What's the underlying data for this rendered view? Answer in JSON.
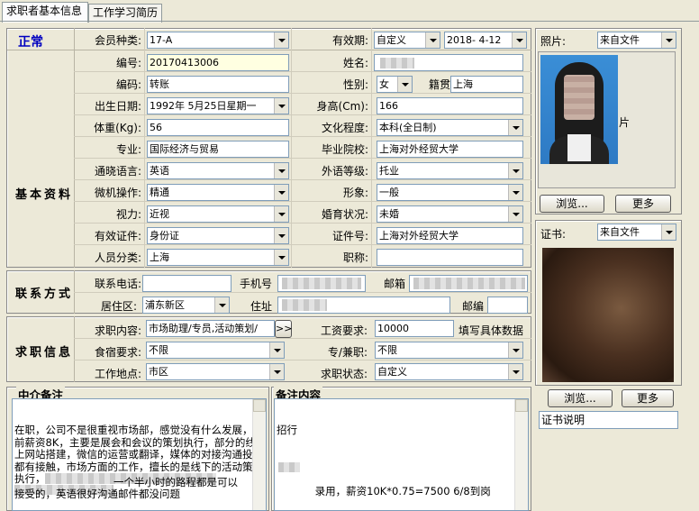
{
  "tabs": [
    {
      "label": "求职者基本信息"
    },
    {
      "label": "工作学习简历"
    }
  ],
  "status": "正常",
  "member_type": {
    "label": "会员种类:",
    "value": "17-A"
  },
  "validity": {
    "label": "有效期:",
    "mode": "自定义",
    "date": "2018- 4-12"
  },
  "photo": {
    "label": "照片:",
    "source": "来自文件",
    "placeholder_text": "片",
    "browse": "浏览...",
    "more": "更多"
  },
  "basic": {
    "section": "基本资料",
    "id": {
      "label": "编号:",
      "value": "20170413006"
    },
    "name": {
      "label": "姓名:"
    },
    "code": {
      "label": "编码:",
      "value": "转账"
    },
    "gender": {
      "label": "性别:",
      "value": "女"
    },
    "native": {
      "label": "籍贯",
      "value": "上海"
    },
    "birth": {
      "label": "出生日期:",
      "value": "1992年 5月25日星期一"
    },
    "height": {
      "label": "身高(Cm):",
      "value": "166"
    },
    "weight": {
      "label": "体重(Kg):",
      "value": "56"
    },
    "education": {
      "label": "文化程度:",
      "value": "本科(全日制)"
    },
    "major": {
      "label": "专业:",
      "value": "国际经济与贸易"
    },
    "school": {
      "label": "毕业院校:",
      "value": "上海对外经贸大学"
    },
    "language": {
      "label": "通晓语言:",
      "value": "英语"
    },
    "lang_level": {
      "label": "外语等级:",
      "value": "托业"
    },
    "computer": {
      "label": "微机操作:",
      "value": "精通"
    },
    "image": {
      "label": "形象:",
      "value": "一般"
    },
    "vision": {
      "label": "视力:",
      "value": "近视"
    },
    "marital": {
      "label": "婚育状况:",
      "value": "未婚"
    },
    "doc": {
      "label": "有效证件:",
      "value": "身份证"
    },
    "doc_no": {
      "label": "证件号:",
      "value": "上海对外经贸大学"
    },
    "category": {
      "label": "人员分类:",
      "value": "上海"
    },
    "title": {
      "label": "职称:",
      "value": ""
    }
  },
  "contact": {
    "section": "联系方式",
    "phone": {
      "label": "联系电话:"
    },
    "mobile": {
      "label": "手机号"
    },
    "email": {
      "label": "邮箱"
    },
    "district": {
      "label": "居住区:",
      "value": "浦东新区"
    },
    "address": {
      "label": "住址"
    },
    "zip": {
      "label": "邮编"
    }
  },
  "job": {
    "section": "求职信息",
    "content": {
      "label": "求职内容:",
      "value": "市场助理/专员,活动策划/",
      "more": ">>"
    },
    "salary": {
      "label": "工资要求:",
      "value": "10000",
      "hint": "填写具体数据"
    },
    "board": {
      "label": "食宿要求:",
      "value": "不限"
    },
    "fulltime": {
      "label": "专/兼职:",
      "value": "不限"
    },
    "location": {
      "label": "工作地点:",
      "value": "市区"
    },
    "state": {
      "label": "求职状态:",
      "value": "自定义"
    }
  },
  "cert": {
    "label": "证书:",
    "source": "来自文件",
    "browse": "浏览...",
    "more": "更多",
    "desc": "证书说明"
  },
  "agent_notes": {
    "title": "中介备注",
    "text": "在职，公司不是很重视市场部，感觉没有什么发展，目前薪资8K，主要是展会和会议的策划执行，部分的线上网站搭建，微信的运营或翻译，媒体的对接沟通投放都有接触，市场方面的工作，擅长的是线下的活动策划执行，线上也愿意尝试的，",
    "tail1": "一个半小时的路程都是可以",
    "tail2": "接受的，英语很好沟通邮件都没问题"
  },
  "remarks": {
    "title": "备注内容",
    "line1": "招行",
    "line2": "录用，薪资10K*0.75=7500 6/8到岗"
  }
}
